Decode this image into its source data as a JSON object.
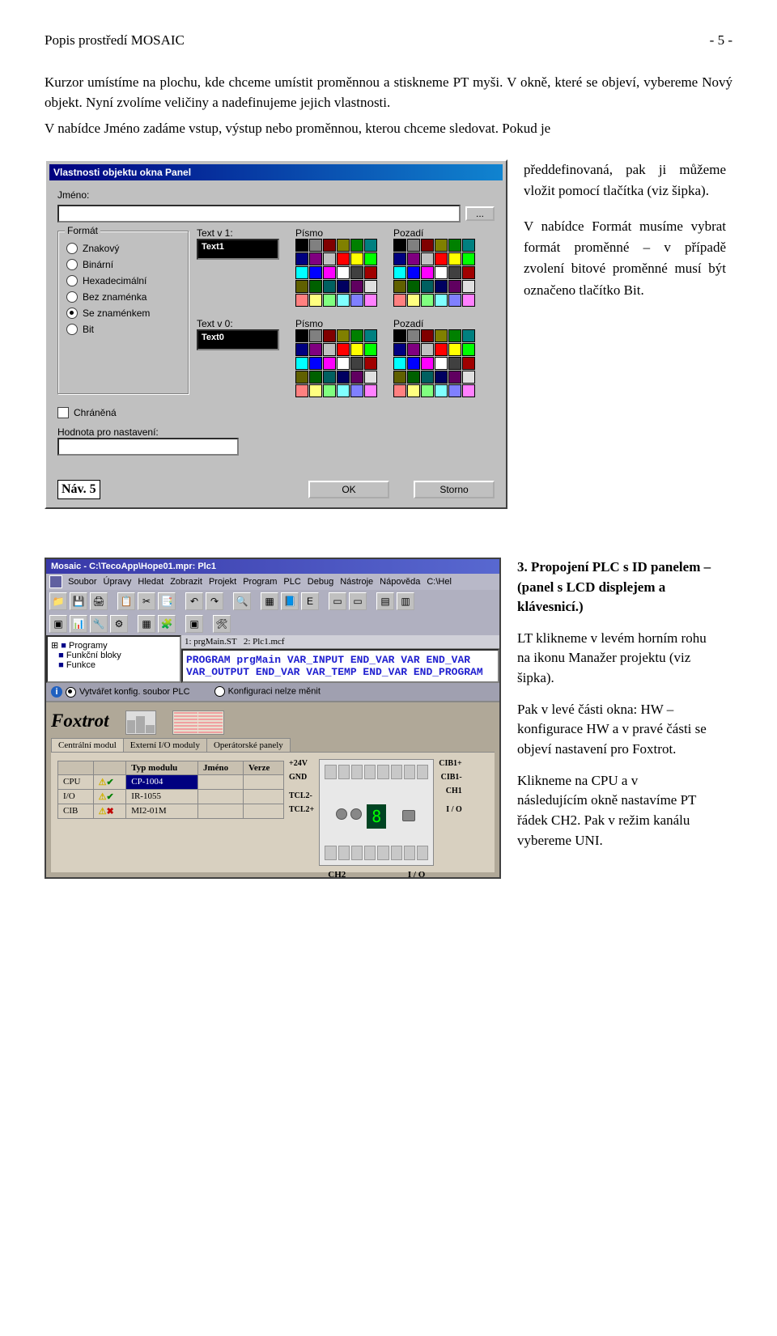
{
  "header": {
    "left": "Popis prostředí MOSAIC",
    "right": "- 5 -"
  },
  "para1": "Kurzor umístíme na plochu, kde chceme umístit proměnnou a stiskneme PT myši. V okně, které se objeví, vybereme Nový objekt. Nyní zvolíme veličiny a nadefinujeme jejich vlastnosti.",
  "para2a": "V nabídce Jméno zadáme vstup, výstup nebo proměnnou, kterou chceme sledovat. Pokud je",
  "dialog": {
    "title": "Vlastnosti objektu okna Panel",
    "label_jmeno": "Jméno:",
    "btn_dots": "...",
    "group_format_title": "Formát",
    "radios": [
      "Znakový",
      "Binární",
      "Hexadecimální",
      "Bez znaménka",
      "Se znaménkem",
      "Bit"
    ],
    "radio_selected_index": 4,
    "text_v1_label": "Text v 1:",
    "text_v1_value": "Text1",
    "text_v0_label": "Text v 0:",
    "text_v0_value": "Text0",
    "pismo_label": "Písmo",
    "pozadi_label": "Pozadí",
    "chranena_label": "Chráněná",
    "hodnota_label": "Hodnota pro nastavení:",
    "btn_ok": "OK",
    "btn_storno": "Storno",
    "palette_colors": [
      "#000000",
      "#808080",
      "#800000",
      "#808000",
      "#008000",
      "#008080",
      "#000080",
      "#800080",
      "#c0c0c0",
      "#ff0000",
      "#ffff00",
      "#00ff00",
      "#00ffff",
      "#0000ff",
      "#ff00ff",
      "#ffffff",
      "#404040",
      "#a00000",
      "#606000",
      "#006000",
      "#006060",
      "#000060",
      "#600060",
      "#e0e0e0",
      "#ff8080",
      "#ffff80",
      "#80ff80",
      "#80ffff",
      "#8080ff",
      "#ff80ff"
    ]
  },
  "side_text1": "předdefinovaná, pak ji můžeme vložit pomocí tlačítka (viz šipka).",
  "side_text2": "V nabídce Formát musíme vybrat formát proměnné – v případě zvolení bitové proměnné musí být označeno tlačítko Bit.",
  "fig_label": "Náv. 5",
  "section3_heading_num": "3.",
  "section3_heading": "Propojení PLC s ID panelem – (panel s LCD displejem a klávesnicí.)",
  "section3_p1": "LT klikneme v levém horním rohu na ikonu Manažer projektu (viz šipka).",
  "section3_p2": "Pak v levé části okna: HW – konfigurace HW a v pravé části se objeví nastavení pro Foxtrot.",
  "section3_p3": "Klikneme na CPU a v následujícím okně nastavíme PT řádek CH2. Pak v režim kanálu vybereme UNI.",
  "mosaic": {
    "title": "Mosaic - C:\\TecoApp\\Hope01.mpr: Plc1",
    "menu": [
      "Soubor",
      "Úpravy",
      "Hledat",
      "Zobrazit",
      "Projekt",
      "Program",
      "PLC",
      "Debug",
      "Nástroje",
      "Nápověda",
      "C:\\Hel"
    ],
    "tree_items": [
      "Programy",
      "Funkční bloky",
      "Funkce"
    ],
    "code_tab1": "1: prgMain.ST",
    "code_tab2": "2: Plc1.mcf",
    "code_lines": [
      "PROGRAM prgMain",
      "  VAR_INPUT",
      "  END_VAR",
      "  VAR",
      "  END_VAR",
      "  VAR_OUTPUT",
      "  END_VAR",
      "  VAR_TEMP",
      "  END_VAR",
      "",
      "END_PROGRAM"
    ],
    "status_opt1": "Vytvářet konfig. soubor PLC",
    "status_opt2": "Konfiguraci nelze měnit"
  },
  "foxtrot": {
    "title": "Foxtrot",
    "tabs": [
      "Centrální modul",
      "Externí I/O moduly",
      "Operátorské panely"
    ],
    "headers": [
      "",
      "",
      "Typ modulu",
      "Jméno",
      "Verze"
    ],
    "rows": [
      {
        "label": "CPU",
        "warn": true,
        "ok": true,
        "typ": "CP-1004",
        "sel": true
      },
      {
        "label": "I/O",
        "warn": true,
        "ok": true,
        "typ": "IR-1055",
        "sel": false
      },
      {
        "label": "CIB",
        "warn": true,
        "ok": false,
        "typ": "MI2-01M",
        "sel": false
      }
    ],
    "signals_left": [
      "+24V",
      "GND",
      "",
      "TCL2-",
      "TCL2+"
    ],
    "signals_right": [
      "CIB1+",
      "CIB1-",
      "CH1",
      "",
      "I / O"
    ],
    "bottom_left": "CH2",
    "bottom_right": "I / O",
    "disp": "8"
  }
}
